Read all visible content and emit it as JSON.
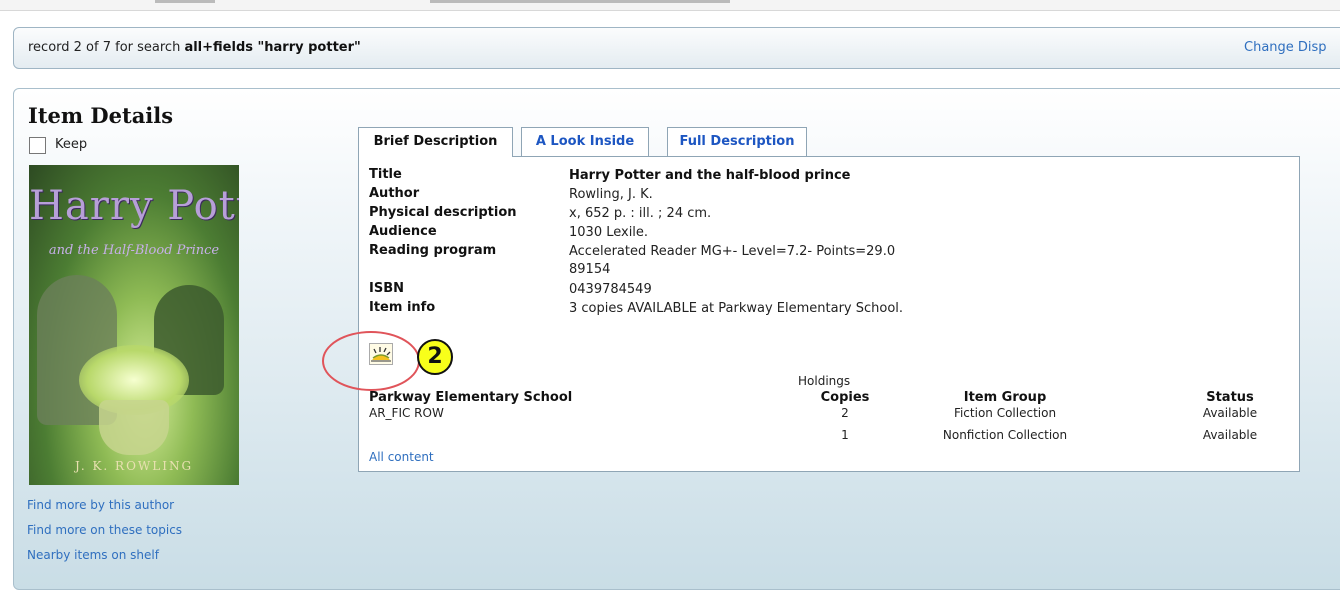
{
  "search_bar": {
    "record_text": "record 2 of 7 for search ",
    "search_terms": "all+fields \"harry potter\"",
    "change_display": "Change Disp"
  },
  "item_details": {
    "heading": "Item Details",
    "keep_label": "Keep",
    "cover": {
      "title": "Harry Potter",
      "subtitle": "and the Half-Blood Prince",
      "author": "J. K. ROWLING"
    },
    "side_links": [
      "Find more by this author",
      "Find more on these topics",
      "Nearby items on shelf"
    ]
  },
  "tabs": [
    {
      "label": "Brief Description",
      "active": true
    },
    {
      "label": "A Look Inside",
      "active": false
    },
    {
      "label": "Full Description",
      "active": false
    }
  ],
  "brief": {
    "rows": [
      {
        "label": "Title",
        "value": "Harry Potter and the half-blood prince",
        "bold": true
      },
      {
        "label": "Author",
        "value": "Rowling, J. K."
      },
      {
        "label": "Physical description",
        "value": "x, 652 p. : ill. ; 24 cm."
      },
      {
        "label": "Audience",
        "value": "1030 Lexile."
      },
      {
        "label": "Reading program",
        "value": "Accelerated Reader MG+- Level=7.2- Points=29.0",
        "value2": "89154"
      },
      {
        "label": "ISBN",
        "value": "0439784549"
      },
      {
        "label": "Item info",
        "value": "3 copies AVAILABLE at Parkway Elementary School."
      }
    ]
  },
  "annotation": {
    "number": "2",
    "ring_color": "#e0545a",
    "badge_color": "#f8ff1a"
  },
  "holdings": {
    "caption": "Holdings",
    "location": "Parkway Elementary School",
    "call_number": "AR_FIC ROW",
    "headers": {
      "copies": "Copies",
      "item_group": "Item Group",
      "status": "Status"
    },
    "rows": [
      {
        "copies": "2",
        "item_group": "Fiction Collection",
        "status": "Available"
      },
      {
        "copies": "1",
        "item_group": "Nonfiction Collection",
        "status": "Available"
      }
    ],
    "all_content": "All content"
  },
  "colors": {
    "link": "#2f6fbf",
    "tab_link": "#1d56c2",
    "border": "#8fa5b5"
  }
}
